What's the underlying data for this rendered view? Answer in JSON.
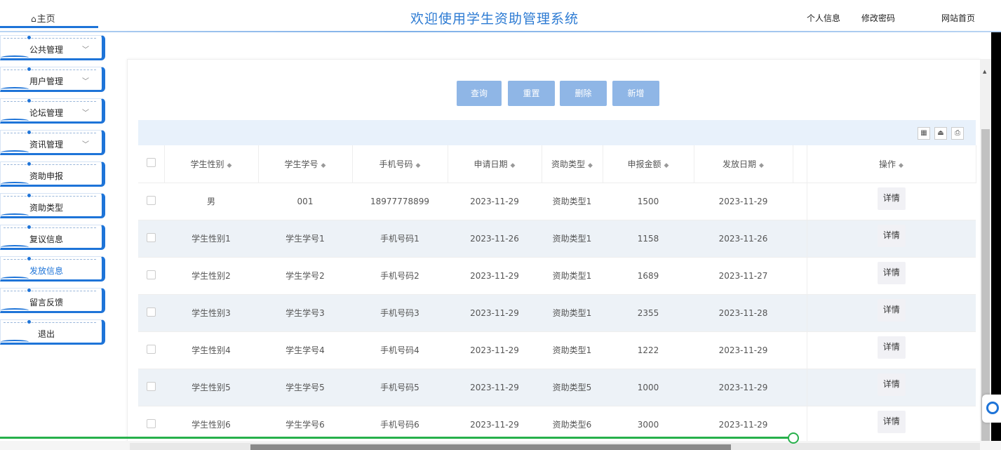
{
  "header": {
    "home_label": "主页",
    "title": "欢迎使用学生资助管理系统",
    "links": [
      "个人信息",
      "修改密码",
      "网站首页"
    ]
  },
  "sidebar": {
    "items": [
      {
        "label": "公共管理",
        "has_chevron": true
      },
      {
        "label": "用户管理",
        "has_chevron": true
      },
      {
        "label": "论坛管理",
        "has_chevron": true
      },
      {
        "label": "资讯管理",
        "has_chevron": true
      },
      {
        "label": "资助申报",
        "has_chevron": false
      },
      {
        "label": "资助类型",
        "has_chevron": false
      },
      {
        "label": "复议信息",
        "has_chevron": false
      },
      {
        "label": "发放信息",
        "has_chevron": false,
        "active": true
      },
      {
        "label": "留言反馈",
        "has_chevron": false
      },
      {
        "label": "退出",
        "has_chevron": false
      }
    ]
  },
  "toolbar": {
    "query_label": "查询",
    "reset_label": "重置",
    "delete_label": "删除",
    "add_label": "新增",
    "icons": [
      "columns-icon",
      "export-icon",
      "print-icon"
    ]
  },
  "table": {
    "columns": [
      "学生性别",
      "学生学号",
      "手机号码",
      "申请日期",
      "资助类型",
      "申报金额",
      "发放日期",
      "操作"
    ],
    "detail_label": "详情",
    "rows": [
      [
        "男",
        "001",
        "18977778899",
        "2023-11-29",
        "资助类型1",
        "1500",
        "2023-11-29"
      ],
      [
        "学生性别1",
        "学生学号1",
        "手机号码1",
        "2023-11-26",
        "资助类型1",
        "1158",
        "2023-11-26"
      ],
      [
        "学生性别2",
        "学生学号2",
        "手机号码2",
        "2023-11-29",
        "资助类型1",
        "1689",
        "2023-11-27"
      ],
      [
        "学生性别3",
        "学生学号3",
        "手机号码3",
        "2023-11-29",
        "资助类型1",
        "2355",
        "2023-11-28"
      ],
      [
        "学生性别4",
        "学生学号4",
        "手机号码4",
        "2023-11-29",
        "资助类型1",
        "1222",
        "2023-11-29"
      ],
      [
        "学生性别5",
        "学生学号5",
        "手机号码5",
        "2023-11-29",
        "资助类型5",
        "1000",
        "2023-11-29"
      ],
      [
        "学生性别6",
        "学生学号6",
        "手机号码6",
        "2023-11-29",
        "资助类型6",
        "3000",
        "2023-11-29"
      ]
    ]
  },
  "colors": {
    "accent": "#1e74d8",
    "button": "#8fb6e6",
    "progress": "#27b04b"
  }
}
